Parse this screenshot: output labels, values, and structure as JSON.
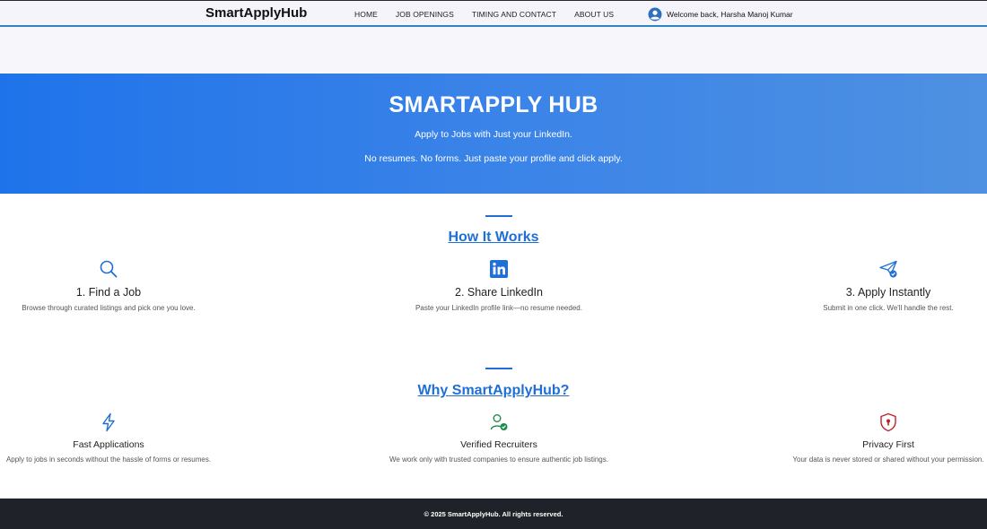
{
  "navbar": {
    "brand": "SmartApplyHub",
    "links": [
      "HOME",
      "JOB OPENINGS",
      "TIMING AND CONTACT",
      "ABOUT US"
    ],
    "welcome": "Welcome back, Harsha Manoj Kumar",
    "user_icon": "user-circle-icon"
  },
  "hero": {
    "title": "SMARTAPPLY HUB",
    "line1": "Apply to Jobs with Just your LinkedIn.",
    "line2": "No resumes. No forms. Just paste your profile and click apply."
  },
  "how_it_works": {
    "title": "How It Works",
    "steps": [
      {
        "icon": "search-icon",
        "title": "1. Find a Job",
        "desc": "Browse through curated listings and pick one you love."
      },
      {
        "icon": "linkedin-icon",
        "title": "2. Share LinkedIn",
        "desc": "Paste your LinkedIn profile link—no resume needed."
      },
      {
        "icon": "send-check-icon",
        "title": "3. Apply Instantly",
        "desc": "Submit in one click. We'll handle the rest."
      }
    ]
  },
  "why": {
    "title": "Why SmartApplyHub?",
    "items": [
      {
        "icon": "lightning-icon",
        "title": "Fast Applications",
        "desc": "Apply to jobs in seconds without the hassle of forms or resumes."
      },
      {
        "icon": "person-check-icon",
        "title": "Verified Recruiters",
        "desc": "We work only with trusted companies to ensure authentic job listings."
      },
      {
        "icon": "shield-lock-icon",
        "title": "Privacy First",
        "desc": "Your data is never stored or shared without your permission."
      }
    ]
  },
  "footer": {
    "text": "© 2025 SmartApplyHub. All rights reserved."
  },
  "colors": {
    "accent": "#1f6fd6",
    "hero_start": "#1f73ea",
    "hero_end": "#4e91e2",
    "footer_bg": "#1f2228",
    "verified_green": "#1e8a4a",
    "privacy_red": "#c0202a"
  }
}
